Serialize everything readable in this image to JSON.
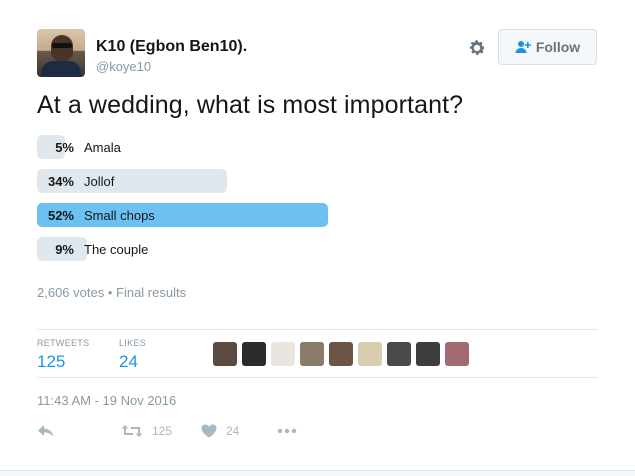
{
  "user": {
    "display_name": "K10 (Egbon Ben10).",
    "handle": "@koye10"
  },
  "header": {
    "follow_label": "Follow"
  },
  "tweet": {
    "question": "At a wedding, what is most important?"
  },
  "poll": {
    "options": [
      {
        "percent_label": "5%",
        "label": "Amala",
        "percent": 5,
        "winner": false
      },
      {
        "percent_label": "34%",
        "label": "Jollof",
        "percent": 34,
        "winner": false
      },
      {
        "percent_label": "52%",
        "label": "Small chops",
        "percent": 52,
        "winner": true
      },
      {
        "percent_label": "9%",
        "label": "The couple",
        "percent": 9,
        "winner": false
      }
    ],
    "votes_text": "2,606 votes",
    "status_text": "Final results"
  },
  "stats": {
    "retweets_label": "RETWEETS",
    "retweets_value": "125",
    "likes_label": "LIKES",
    "likes_value": "24"
  },
  "likers": [
    {
      "color": "#5b4a40"
    },
    {
      "color": "#2b2b2b"
    },
    {
      "color": "#e9e6e0"
    },
    {
      "color": "#8a7a6a"
    },
    {
      "color": "#6d5545"
    },
    {
      "color": "#d9cdb0"
    },
    {
      "color": "#4a4a4a"
    },
    {
      "color": "#3d3d3d"
    },
    {
      "color": "#a46a72"
    }
  ],
  "timestamp": "11:43 AM - 19 Nov 2016",
  "actions": {
    "retweet_count": "125",
    "like_count": "24"
  },
  "colors": {
    "accent": "#1b95e0",
    "winner_bar": "#6cc1f2",
    "bar": "#e1e8ed",
    "muted": "#8899a6"
  }
}
